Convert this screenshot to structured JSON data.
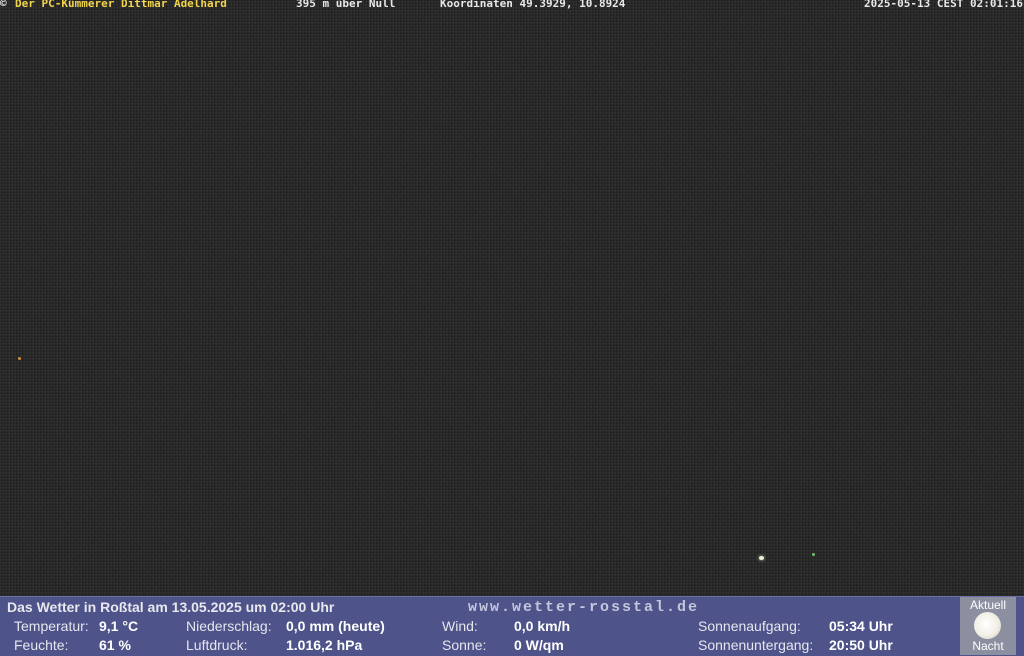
{
  "overlay": {
    "copyright": "©",
    "owner": "Der PC-Kümmerer Dittmar Adelhard",
    "altitude": "395 m über Null",
    "coordinates": "Koordinaten 49.3929, 10.8924",
    "timestamp": "2025-05-13 CEST 02:01:16"
  },
  "weather": {
    "headline": "Das Wetter in Roßtal am 13.05.2025 um 02:00 Uhr",
    "website": "www.wetter-rosstal.de",
    "temperature_label": "Temperatur:",
    "temperature_value": "9,1 °C",
    "humidity_label": "Feuchte:",
    "humidity_value": "61 %",
    "precip_label": "Niederschlag:",
    "precip_value": "0,0 mm (heute)",
    "pressure_label": "Luftdruck:",
    "pressure_value": "1.016,2 hPa",
    "wind_label": "Wind:",
    "wind_value": "0,0 km/h",
    "sun_label": "Sonne:",
    "sun_value": "0 W/qm",
    "sunrise_label": "Sonnenaufgang:",
    "sunrise_value": "05:34 Uhr",
    "sunset_label": "Sonnenuntergang:",
    "sunset_value": "20:50 Uhr"
  },
  "moon": {
    "top_label": "Aktuell",
    "bottom_label": "Nacht",
    "icon": "full-moon-icon"
  }
}
